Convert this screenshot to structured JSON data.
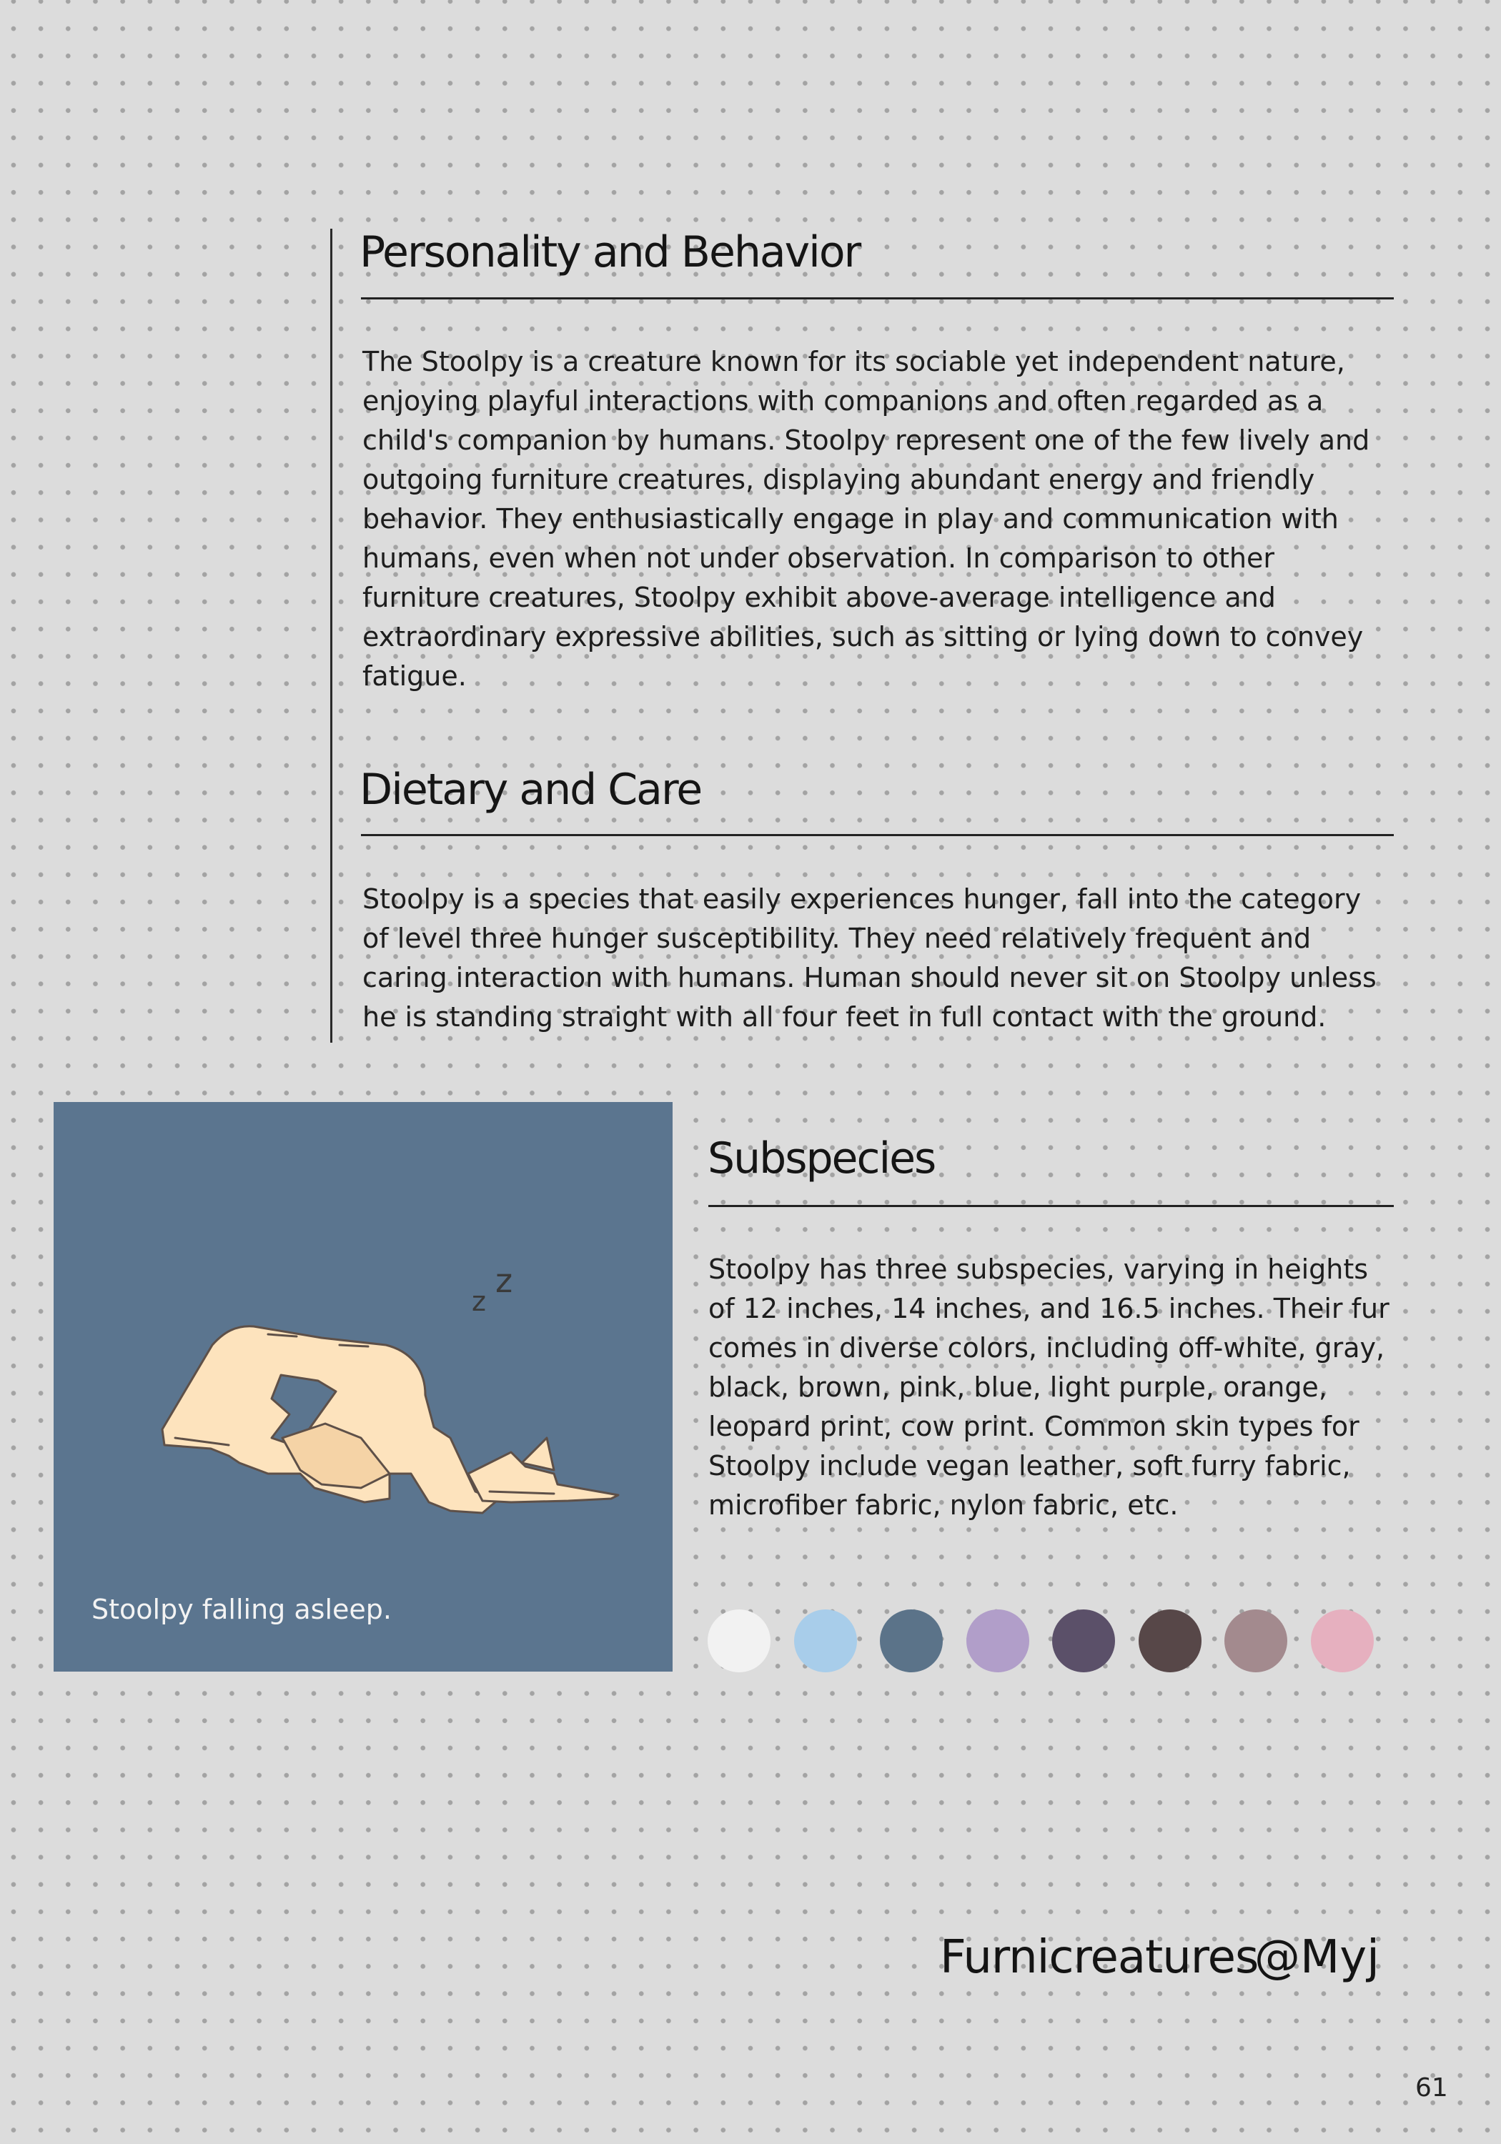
{
  "sections": {
    "personality": {
      "heading": "Personality and Behavior",
      "lines": [
        "The Stoolpy is a creature known for its sociable yet independent nature,",
        "enjoying playful interactions with companions and often regarded as a",
        "child's companion by humans. Stoolpy represent one of the few lively and",
        "outgoing furniture creatures, displaying abundant energy and friendly",
        "behavior. They enthusiastically engage in play and communication with",
        "humans, even when not under observation. In comparison to other",
        "furniture creatures, Stoolpy exhibit above-average intelligence and",
        "extraordinary expressive abilities, such as sitting or lying down to convey",
        "fatigue."
      ]
    },
    "dietary": {
      "heading": "Dietary and Care",
      "lines": [
        "Stoolpy is a species that easily experiences hunger, fall into the category",
        "of level three hunger susceptibility. They need relatively frequent and",
        "caring interaction with humans. Human should never sit on Stoolpy unless",
        "he is standing straight with all four feet in full contact with the ground."
      ]
    },
    "subspecies": {
      "heading": "Subspecies",
      "lines": [
        "Stoolpy has three subspecies, varying in heights",
        "of 12 inches, 14 inches, and 16.5 inches. Their fur",
        "comes in diverse colors, including off-white, gray,",
        "black, brown, pink, blue, light purple, orange,",
        "leopard print, cow print. Common skin types for",
        "Stoolpy include vegan leather, soft furry fabric,",
        "microfiber fabric, nylon fabric, etc."
      ]
    }
  },
  "illustration": {
    "caption": "Stoolpy falling asleep.",
    "sleep_letters": [
      "z",
      "z"
    ],
    "background_color": "#5b758f",
    "creature_color": "#fde3bd",
    "outline_color": "#5e5048"
  },
  "fur_swatches": [
    {
      "name": "off-white",
      "color": "#f2f2f2"
    },
    {
      "name": "light-blue",
      "color": "#a8cdea"
    },
    {
      "name": "slate-blue",
      "color": "#5b7389"
    },
    {
      "name": "lavender",
      "color": "#b19ec9"
    },
    {
      "name": "dark-purple",
      "color": "#5b5069"
    },
    {
      "name": "dark-brown",
      "color": "#574748"
    },
    {
      "name": "mauve",
      "color": "#a38a8e"
    },
    {
      "name": "pink",
      "color": "#e6b0bf"
    }
  ],
  "footer": {
    "brand": "Furnicreatures",
    "handle": "@Myj",
    "page_number": "61"
  }
}
